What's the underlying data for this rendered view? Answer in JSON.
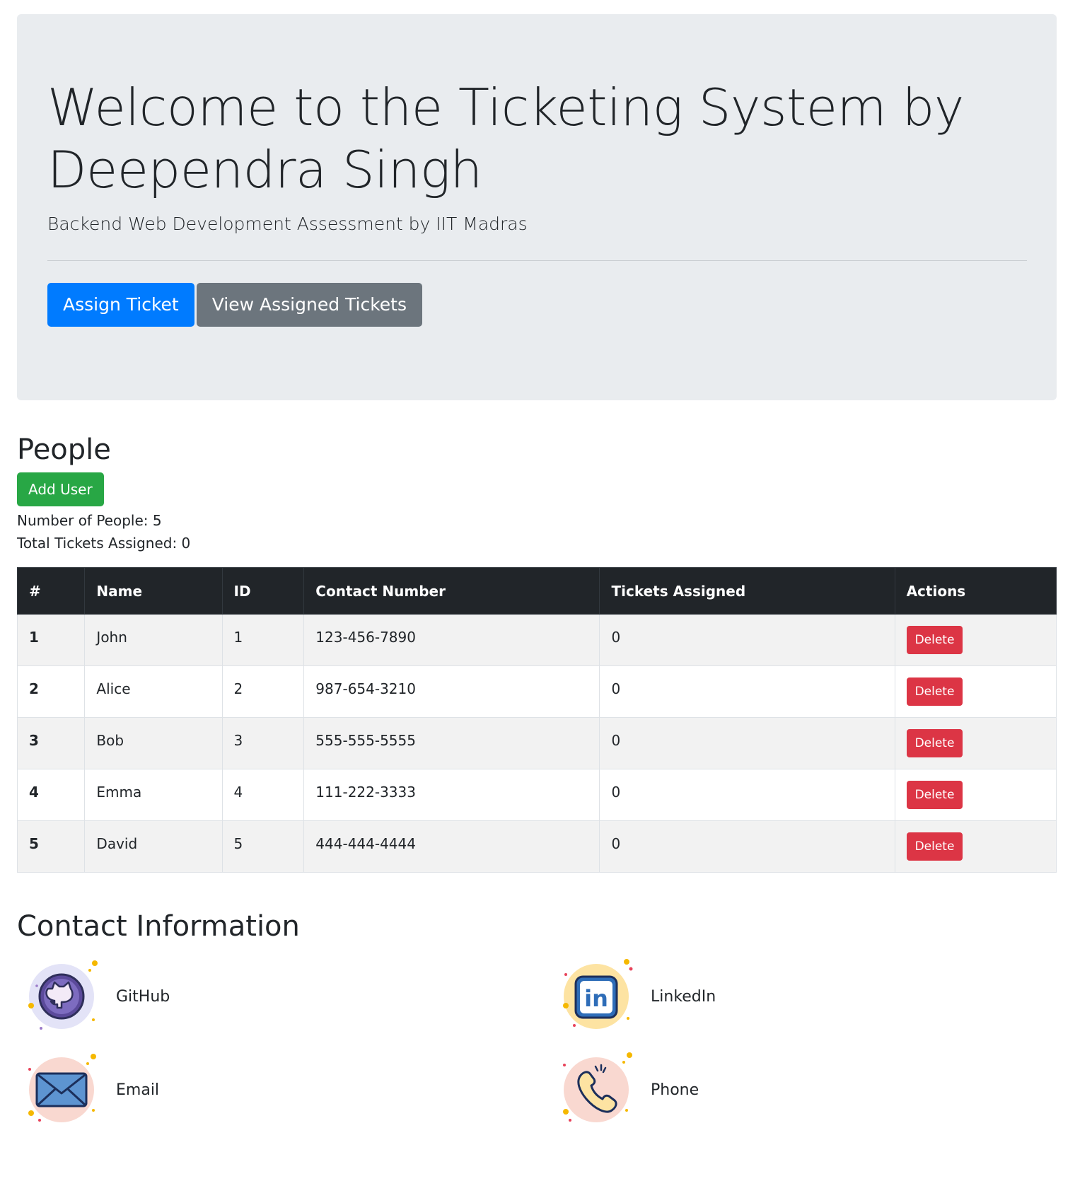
{
  "header": {
    "title": "Welcome to the Ticketing System by Deependra Singh",
    "subtitle": "Backend Web Development Assessment by IIT Madras",
    "assign_button": "Assign Ticket",
    "view_button": "View Assigned Tickets"
  },
  "people": {
    "title": "People",
    "add_button": "Add User",
    "count_text": "Number of People: 5",
    "tickets_text": "Total Tickets Assigned: 0",
    "columns": [
      "#",
      "Name",
      "ID",
      "Contact Number",
      "Tickets Assigned",
      "Actions"
    ],
    "rows": [
      {
        "num": "1",
        "name": "John",
        "id": "1",
        "contact": "123-456-7890",
        "tickets": "0",
        "action": "Delete"
      },
      {
        "num": "2",
        "name": "Alice",
        "id": "2",
        "contact": "987-654-3210",
        "tickets": "0",
        "action": "Delete"
      },
      {
        "num": "3",
        "name": "Bob",
        "id": "3",
        "contact": "555-555-5555",
        "tickets": "0",
        "action": "Delete"
      },
      {
        "num": "4",
        "name": "Emma",
        "id": "4",
        "contact": "111-222-3333",
        "tickets": "0",
        "action": "Delete"
      },
      {
        "num": "5",
        "name": "David",
        "id": "5",
        "contact": "444-444-4444",
        "tickets": "0",
        "action": "Delete"
      }
    ]
  },
  "contact": {
    "title": "Contact Information",
    "items": [
      {
        "label": "GitHub",
        "icon": "github-icon"
      },
      {
        "label": "LinkedIn",
        "icon": "linkedin-icon"
      },
      {
        "label": "Email",
        "icon": "email-icon"
      },
      {
        "label": "Phone",
        "icon": "phone-icon"
      }
    ]
  },
  "colors": {
    "primary": "#007bff",
    "secondary": "#6c757d",
    "success": "#28a745",
    "danger": "#dc3545",
    "table_header": "#212529",
    "jumbotron_bg": "#e9ecef"
  }
}
